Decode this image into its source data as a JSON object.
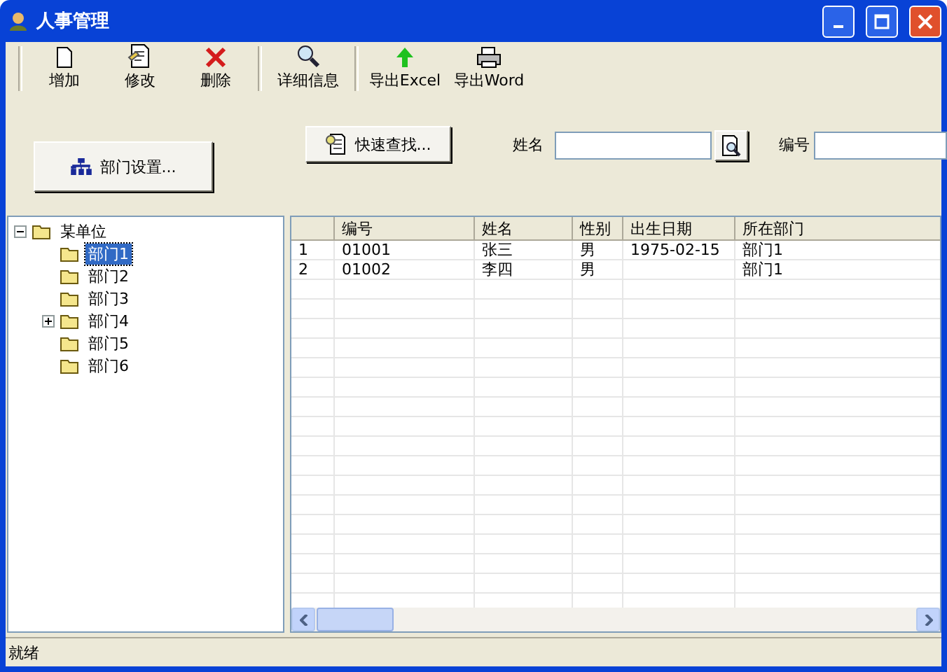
{
  "window": {
    "title": "人事管理"
  },
  "toolbar": [
    {
      "label": "增加",
      "kind": "new"
    },
    {
      "label": "修改",
      "kind": "edit"
    },
    {
      "label": "删除",
      "kind": "delete"
    },
    {
      "label": "详细信息",
      "kind": "search"
    },
    {
      "label": "导出Excel",
      "kind": "export"
    },
    {
      "label": "导出Word",
      "kind": "print"
    }
  ],
  "dept_button": {
    "label": "部门设置..."
  },
  "quick_find_button": {
    "label": "快速查找..."
  },
  "name_field": {
    "label": "姓名"
  },
  "id_field": {
    "label": "编号"
  },
  "tree": {
    "label": "某单位",
    "expanded": true,
    "selected": false,
    "children": [
      {
        "label": "部门1",
        "selected": true,
        "expandable": false
      },
      {
        "label": "部门2",
        "selected": false,
        "expandable": false
      },
      {
        "label": "部门3",
        "selected": false,
        "expandable": false
      },
      {
        "label": "部门4",
        "selected": false,
        "expandable": true
      },
      {
        "label": "部门5",
        "selected": false,
        "expandable": false
      },
      {
        "label": "部门6",
        "selected": false,
        "expandable": false
      }
    ]
  },
  "table": {
    "columns": [
      "编号",
      "姓名",
      "性别",
      "出生日期",
      "所在部门"
    ],
    "rows": [
      {
        "index": "1",
        "cells": [
          "01001",
          "张三",
          "男",
          "1975-02-15",
          "部门1"
        ]
      },
      {
        "index": "2",
        "cells": [
          "01002",
          "李四",
          "男",
          "",
          "部门1"
        ]
      }
    ]
  },
  "status_bar": "就绪"
}
